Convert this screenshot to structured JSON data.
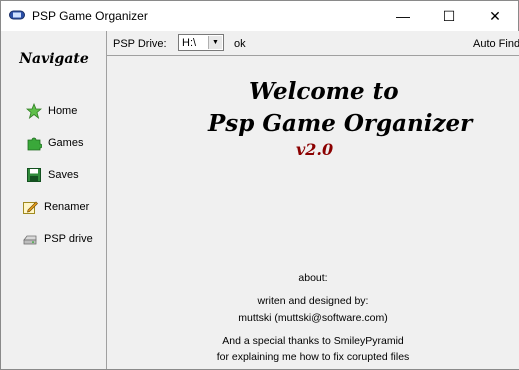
{
  "window": {
    "title": "PSP Game Organizer"
  },
  "titlebar": {
    "minimize": "—",
    "maximize": "☐",
    "close": "✕"
  },
  "sidebar": {
    "title": "Navigate",
    "items": [
      {
        "label": "Home",
        "icon": "star-icon"
      },
      {
        "label": "Games",
        "icon": "puzzle-icon"
      },
      {
        "label": "Saves",
        "icon": "floppy-disk-icon"
      },
      {
        "label": "Renamer",
        "icon": "pencil-notepad-icon"
      },
      {
        "label": "PSP drive",
        "icon": "drive-icon"
      }
    ]
  },
  "toolbar": {
    "drive_label": "PSP Drive:",
    "drive_value": "H:\\",
    "status": "ok",
    "auto_find": "Auto Find"
  },
  "main": {
    "welcome_line1": "Welcome to",
    "welcome_line2": "Psp Game Organizer",
    "version": "v2.0",
    "about_heading": "about:",
    "about_written": "writen and designed by:",
    "about_author": "muttski  (muttski@software.com)",
    "thanks_line1": "And a special thanks to SmileyPyramid",
    "thanks_line2": "for explaining  me how to fix corupted files"
  }
}
